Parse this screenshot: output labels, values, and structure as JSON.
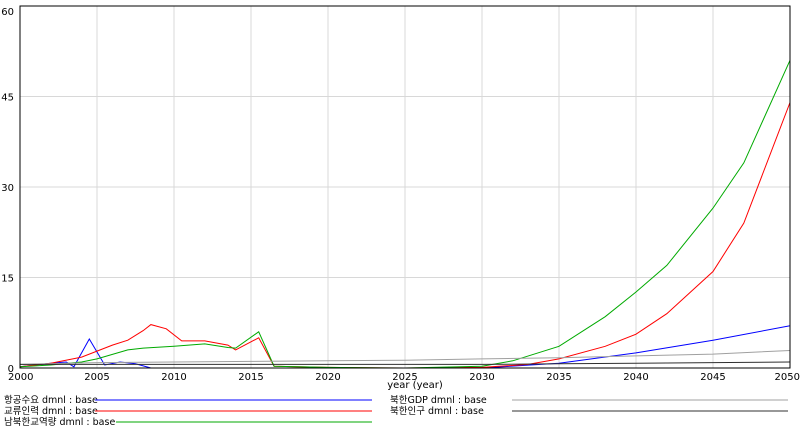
{
  "chart_data": {
    "type": "line",
    "xlabel": "year (year)",
    "xlim": [
      2000,
      2050
    ],
    "ylim": [
      0,
      60
    ],
    "xticks": [
      2000,
      2005,
      2010,
      2015,
      2020,
      2025,
      2030,
      2035,
      2040,
      2045,
      2050
    ],
    "yticks": [
      0,
      15,
      30,
      45,
      60
    ],
    "grid": true,
    "legend_position": "bottom",
    "series": [
      {
        "name": "항공수요 dmnl : base",
        "color": "#0000ff",
        "x": [
          2000,
          2002,
          2003,
          2003.5,
          2004.5,
          2005.5,
          2006.5,
          2007.5,
          2008.5,
          2009,
          2015,
          2020,
          2025,
          2030,
          2035,
          2040,
          2045,
          2050
        ],
        "y": [
          0.2,
          0.8,
          1.0,
          0.2,
          4.8,
          0.5,
          1.0,
          0.7,
          0.0,
          0.0,
          0.0,
          0.0,
          0.0,
          0.0,
          0.8,
          2.5,
          4.6,
          7.0
        ]
      },
      {
        "name": "교류인력 dmnl : base",
        "color": "#ff0000",
        "x": [
          2000,
          2002,
          2004,
          2005,
          2006,
          2007,
          2008,
          2008.5,
          2009.5,
          2010.5,
          2012,
          2013.5,
          2014,
          2015.5,
          2016.5,
          2020,
          2025,
          2030,
          2033,
          2035,
          2038,
          2040,
          2042,
          2045,
          2047,
          2050
        ],
        "y": [
          0.2,
          0.8,
          1.8,
          2.8,
          3.8,
          4.6,
          6.2,
          7.2,
          6.5,
          4.5,
          4.5,
          3.8,
          3.0,
          5.0,
          0.3,
          0.1,
          0.0,
          0.1,
          0.6,
          1.5,
          3.6,
          5.6,
          9.0,
          16.0,
          24.0,
          44.0
        ]
      },
      {
        "name": "남북한교역량 dmnl : base",
        "color": "#00aa00",
        "x": [
          2000,
          2002,
          2004,
          2005,
          2007,
          2008,
          2010,
          2012,
          2013.5,
          2014,
          2015.5,
          2016.5,
          2020,
          2025,
          2030,
          2032,
          2035,
          2038,
          2040,
          2042,
          2045,
          2047,
          2050
        ],
        "y": [
          0.2,
          0.5,
          1.0,
          1.5,
          3.0,
          3.3,
          3.6,
          4.0,
          3.4,
          3.3,
          6.0,
          0.3,
          0.1,
          0.0,
          0.3,
          1.2,
          3.6,
          8.5,
          12.6,
          17.0,
          26.5,
          34.0,
          51.0
        ]
      },
      {
        "name": "북한GDP dmnl : base",
        "color": "#a0a0a0",
        "x": [
          2000,
          2005,
          2010,
          2015,
          2020,
          2025,
          2030,
          2035,
          2040,
          2045,
          2050
        ],
        "y": [
          0.6,
          0.9,
          1.0,
          1.1,
          1.2,
          1.3,
          1.5,
          1.7,
          2.0,
          2.3,
          2.9
        ]
      },
      {
        "name": "북한인구 dmnl : base",
        "color": "#303030",
        "x": [
          2000,
          2005,
          2010,
          2015,
          2020,
          2025,
          2030,
          2035,
          2040,
          2045,
          2050
        ],
        "y": [
          0.6,
          0.6,
          0.6,
          0.6,
          0.6,
          0.6,
          0.6,
          0.7,
          0.8,
          0.9,
          1.0
        ]
      }
    ]
  }
}
